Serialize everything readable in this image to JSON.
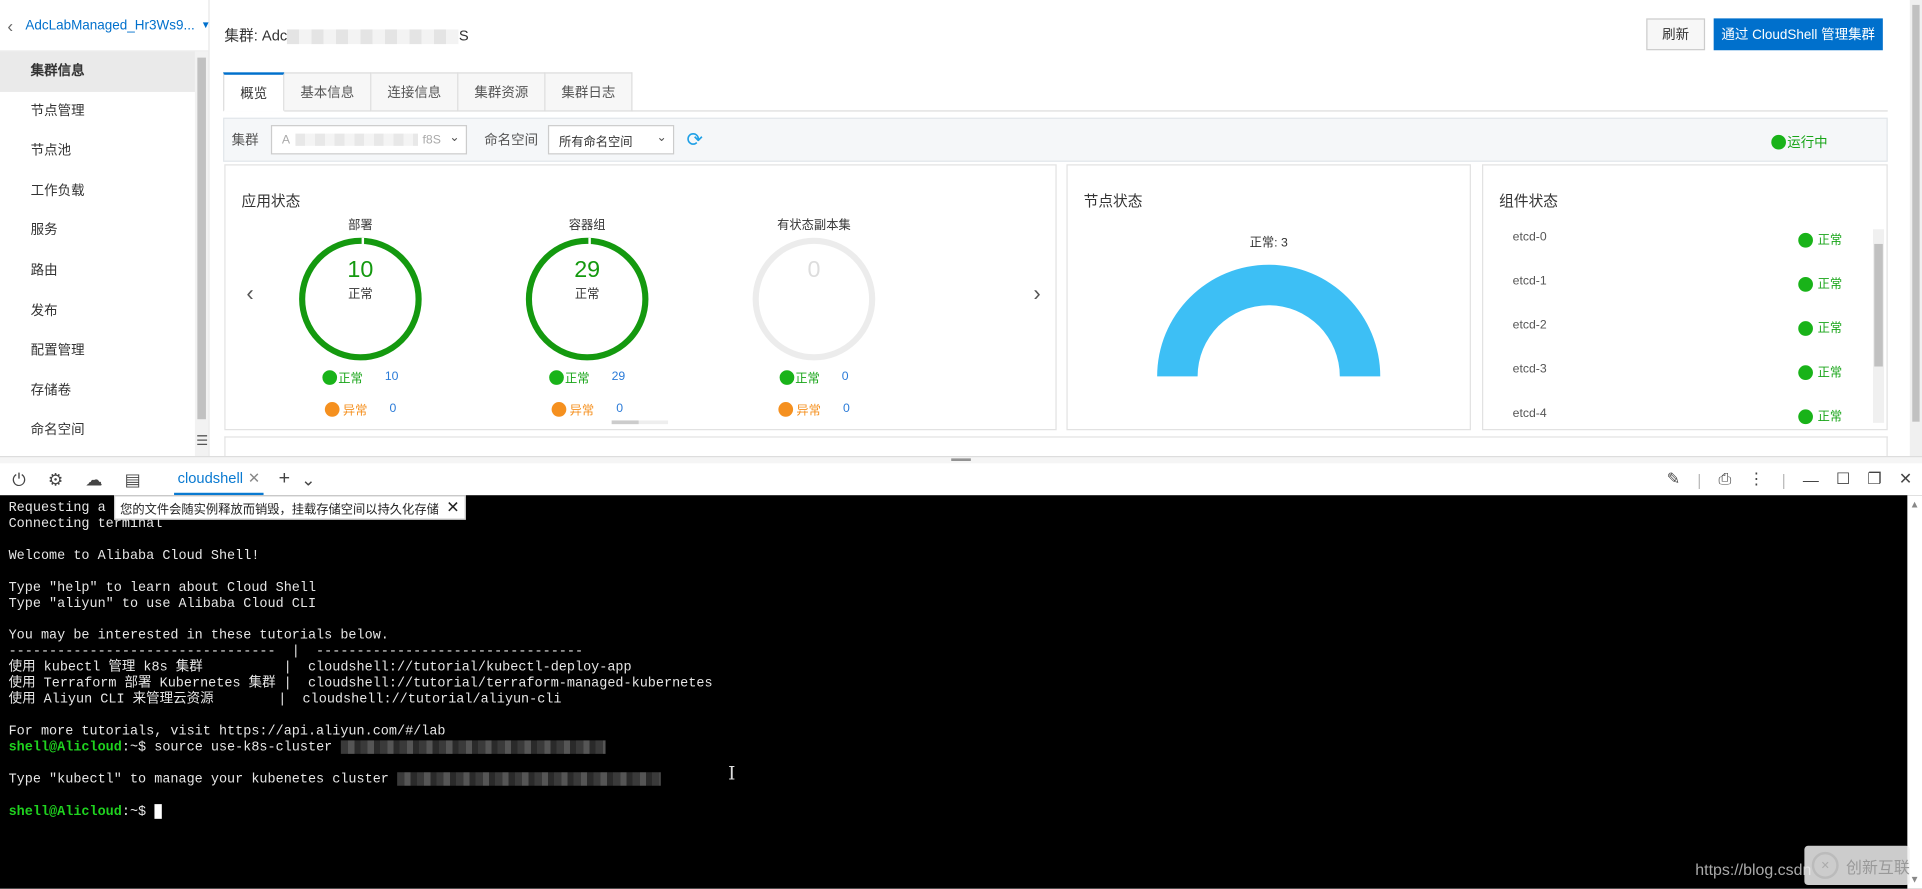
{
  "sidebar": {
    "cluster_name": "AdcLabManaged_Hr3Ws9...",
    "items": [
      {
        "label": "集群信息"
      },
      {
        "label": "节点管理"
      },
      {
        "label": "节点池"
      },
      {
        "label": "工作负载"
      },
      {
        "label": "服务"
      },
      {
        "label": "路由"
      },
      {
        "label": "发布"
      },
      {
        "label": "配置管理"
      },
      {
        "label": "存储卷"
      },
      {
        "label": "命名空间"
      }
    ]
  },
  "header": {
    "title_prefix": "集群: Adc",
    "title_suffix": "S",
    "refresh_label": "刷新",
    "cloudshell_label": "通过 CloudShell 管理集群"
  },
  "tabs": [
    {
      "label": "概览"
    },
    {
      "label": "基本信息"
    },
    {
      "label": "连接信息"
    },
    {
      "label": "集群资源"
    },
    {
      "label": "集群日志"
    }
  ],
  "filter": {
    "cluster_label": "集群",
    "cluster_value_prefix": "A",
    "cluster_value_suffix": "f8S",
    "namespace_label": "命名空间",
    "namespace_value": "所有命名空间",
    "status": "运行中"
  },
  "app_status": {
    "title": "应用状态",
    "rings": [
      {
        "title": "部署",
        "count": "10",
        "state": "正常",
        "ok_label": "正常",
        "ok_value": "10",
        "err_label": "异常",
        "err_value": "0"
      },
      {
        "title": "容器组",
        "count": "29",
        "state": "正常",
        "ok_label": "正常",
        "ok_value": "29",
        "err_label": "异常",
        "err_value": "0"
      },
      {
        "title": "有状态副本集",
        "count": "0",
        "state": "",
        "ok_label": "正常",
        "ok_value": "0",
        "err_label": "异常",
        "err_value": "0"
      }
    ]
  },
  "node_status": {
    "title": "节点状态",
    "label": "正常: 3",
    "normal": 3,
    "gauge_color": "#3dbff5"
  },
  "component_status": {
    "title": "组件状态",
    "items": [
      {
        "name": "etcd-0",
        "status": "正常"
      },
      {
        "name": "etcd-1",
        "status": "正常"
      },
      {
        "name": "etcd-2",
        "status": "正常"
      },
      {
        "name": "etcd-3",
        "status": "正常"
      },
      {
        "name": "etcd-4",
        "status": "正常"
      }
    ]
  },
  "shell": {
    "tab_label": "cloudshell",
    "tooltip": "您的文件会随实例释放而销毁，挂载存储空间以持久化存储",
    "lines": {
      "l1": "Requesting a ",
      "l2": "Connecting terminal",
      "l3": "Welcome to Alibaba Cloud Shell!",
      "l4": "Type \"help\" to learn about Cloud Shell",
      "l5": "Type \"aliyun\" to use Alibaba Cloud CLI",
      "l6": "You may be interested in these tutorials below.",
      "l7": "---------------------------------  |  ---------------------------------",
      "l8": "使用 kubectl 管理 k8s 集群          |  cloudshell://tutorial/kubectl-deploy-app",
      "l9": "使用 Terraform 部署 Kubernetes 集群 |  cloudshell://tutorial/terraform-managed-kubernetes",
      "l10": "使用 Aliyun CLI 来管理云资源        |  cloudshell://tutorial/aliyun-cli",
      "l11": "For more tutorials, visit https://api.aliyun.com/#/lab",
      "prompt": "shell@Alicloud",
      "l12": ":~$ source use-k8s-cluster ",
      "l13": "Type \"kubectl\" to manage your kubenetes cluster ",
      "l14": ":~$ "
    }
  },
  "watermark": {
    "url": "https://blog.csdn",
    "logo_text": "创新互联"
  }
}
